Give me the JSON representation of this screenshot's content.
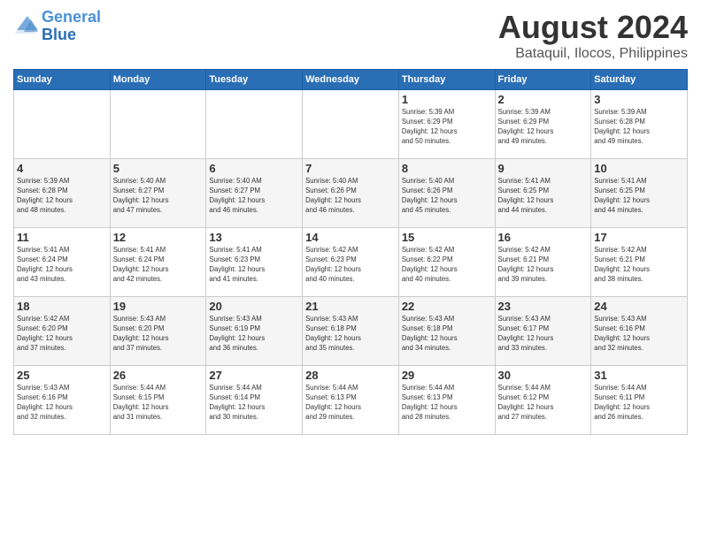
{
  "header": {
    "logo_line1": "General",
    "logo_line2": "Blue",
    "title": "August 2024",
    "subtitle": "Bataquil, Ilocos, Philippines"
  },
  "weekdays": [
    "Sunday",
    "Monday",
    "Tuesday",
    "Wednesday",
    "Thursday",
    "Friday",
    "Saturday"
  ],
  "weeks": [
    [
      {
        "day": "",
        "info": ""
      },
      {
        "day": "",
        "info": ""
      },
      {
        "day": "",
        "info": ""
      },
      {
        "day": "",
        "info": ""
      },
      {
        "day": "1",
        "info": "Sunrise: 5:39 AM\nSunset: 6:29 PM\nDaylight: 12 hours\nand 50 minutes."
      },
      {
        "day": "2",
        "info": "Sunrise: 5:39 AM\nSunset: 6:29 PM\nDaylight: 12 hours\nand 49 minutes."
      },
      {
        "day": "3",
        "info": "Sunrise: 5:39 AM\nSunset: 6:28 PM\nDaylight: 12 hours\nand 49 minutes."
      }
    ],
    [
      {
        "day": "4",
        "info": "Sunrise: 5:39 AM\nSunset: 6:28 PM\nDaylight: 12 hours\nand 48 minutes."
      },
      {
        "day": "5",
        "info": "Sunrise: 5:40 AM\nSunset: 6:27 PM\nDaylight: 12 hours\nand 47 minutes."
      },
      {
        "day": "6",
        "info": "Sunrise: 5:40 AM\nSunset: 6:27 PM\nDaylight: 12 hours\nand 46 minutes."
      },
      {
        "day": "7",
        "info": "Sunrise: 5:40 AM\nSunset: 6:26 PM\nDaylight: 12 hours\nand 46 minutes."
      },
      {
        "day": "8",
        "info": "Sunrise: 5:40 AM\nSunset: 6:26 PM\nDaylight: 12 hours\nand 45 minutes."
      },
      {
        "day": "9",
        "info": "Sunrise: 5:41 AM\nSunset: 6:25 PM\nDaylight: 12 hours\nand 44 minutes."
      },
      {
        "day": "10",
        "info": "Sunrise: 5:41 AM\nSunset: 6:25 PM\nDaylight: 12 hours\nand 44 minutes."
      }
    ],
    [
      {
        "day": "11",
        "info": "Sunrise: 5:41 AM\nSunset: 6:24 PM\nDaylight: 12 hours\nand 43 minutes."
      },
      {
        "day": "12",
        "info": "Sunrise: 5:41 AM\nSunset: 6:24 PM\nDaylight: 12 hours\nand 42 minutes."
      },
      {
        "day": "13",
        "info": "Sunrise: 5:41 AM\nSunset: 6:23 PM\nDaylight: 12 hours\nand 41 minutes."
      },
      {
        "day": "14",
        "info": "Sunrise: 5:42 AM\nSunset: 6:23 PM\nDaylight: 12 hours\nand 40 minutes."
      },
      {
        "day": "15",
        "info": "Sunrise: 5:42 AM\nSunset: 6:22 PM\nDaylight: 12 hours\nand 40 minutes."
      },
      {
        "day": "16",
        "info": "Sunrise: 5:42 AM\nSunset: 6:21 PM\nDaylight: 12 hours\nand 39 minutes."
      },
      {
        "day": "17",
        "info": "Sunrise: 5:42 AM\nSunset: 6:21 PM\nDaylight: 12 hours\nand 38 minutes."
      }
    ],
    [
      {
        "day": "18",
        "info": "Sunrise: 5:42 AM\nSunset: 6:20 PM\nDaylight: 12 hours\nand 37 minutes."
      },
      {
        "day": "19",
        "info": "Sunrise: 5:43 AM\nSunset: 6:20 PM\nDaylight: 12 hours\nand 37 minutes."
      },
      {
        "day": "20",
        "info": "Sunrise: 5:43 AM\nSunset: 6:19 PM\nDaylight: 12 hours\nand 36 minutes."
      },
      {
        "day": "21",
        "info": "Sunrise: 5:43 AM\nSunset: 6:18 PM\nDaylight: 12 hours\nand 35 minutes."
      },
      {
        "day": "22",
        "info": "Sunrise: 5:43 AM\nSunset: 6:18 PM\nDaylight: 12 hours\nand 34 minutes."
      },
      {
        "day": "23",
        "info": "Sunrise: 5:43 AM\nSunset: 6:17 PM\nDaylight: 12 hours\nand 33 minutes."
      },
      {
        "day": "24",
        "info": "Sunrise: 5:43 AM\nSunset: 6:16 PM\nDaylight: 12 hours\nand 32 minutes."
      }
    ],
    [
      {
        "day": "25",
        "info": "Sunrise: 5:43 AM\nSunset: 6:16 PM\nDaylight: 12 hours\nand 32 minutes."
      },
      {
        "day": "26",
        "info": "Sunrise: 5:44 AM\nSunset: 6:15 PM\nDaylight: 12 hours\nand 31 minutes."
      },
      {
        "day": "27",
        "info": "Sunrise: 5:44 AM\nSunset: 6:14 PM\nDaylight: 12 hours\nand 30 minutes."
      },
      {
        "day": "28",
        "info": "Sunrise: 5:44 AM\nSunset: 6:13 PM\nDaylight: 12 hours\nand 29 minutes."
      },
      {
        "day": "29",
        "info": "Sunrise: 5:44 AM\nSunset: 6:13 PM\nDaylight: 12 hours\nand 28 minutes."
      },
      {
        "day": "30",
        "info": "Sunrise: 5:44 AM\nSunset: 6:12 PM\nDaylight: 12 hours\nand 27 minutes."
      },
      {
        "day": "31",
        "info": "Sunrise: 5:44 AM\nSunset: 6:11 PM\nDaylight: 12 hours\nand 26 minutes."
      }
    ]
  ]
}
